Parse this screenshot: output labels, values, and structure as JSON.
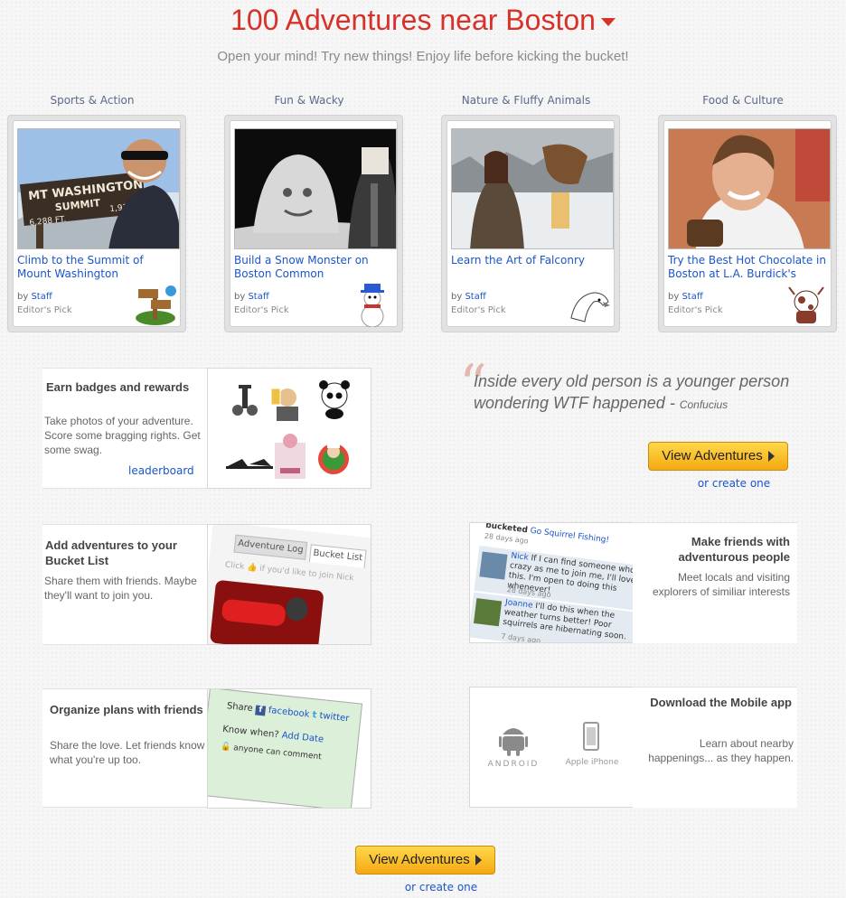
{
  "header": {
    "title": "100 Adventures near Boston",
    "tagline": "Open your mind!  Try new things!  Enjoy life before kicking the bucket!"
  },
  "categories": [
    {
      "label": "Sports & Action",
      "title": "Climb to the Summit of Mount Washington",
      "by_prefix": "by",
      "author": "Staff",
      "pick": "Editor's Pick",
      "sign": {
        "line1": "MT WASHINGTON",
        "line2": "SUMMIT",
        "left": "6,288 FT.",
        "right": "1,917M"
      }
    },
    {
      "label": "Fun & Wacky",
      "title": "Build a Snow Monster on Boston Common",
      "by_prefix": "by",
      "author": "Staff",
      "pick": "Editor's Pick"
    },
    {
      "label": "Nature & Fluffy Animals",
      "title": "Learn the Art of Falconry",
      "by_prefix": "by",
      "author": "Staff",
      "pick": "Editor's Pick"
    },
    {
      "label": "Food & Culture",
      "title": "Try the Best Hot Chocolate in Boston at L.A. Burdick's",
      "by_prefix": "by",
      "author": "Staff",
      "pick": "Editor's Pick"
    }
  ],
  "badges": {
    "heading": "Earn badges and rewards",
    "body": "Take photos of your adventure. Score some bragging rights. Get some swag.",
    "link": "leaderboard"
  },
  "quote": {
    "text": "Inside every old person is a younger person wondering WTF happened",
    "dash": " - ",
    "author": "Confucius"
  },
  "cta_top": {
    "button": "View Adventures",
    "link": "or create one"
  },
  "bucket": {
    "heading": "Add adventures to your Bucket List",
    "body": "Share them with friends. Maybe they'll want to join you.",
    "tab1": "Adventure Log",
    "tab2": "Bucket List",
    "click": "Click",
    "join_text": "if you'd like to join Nick"
  },
  "friends": {
    "heading": "Make friends with adventurous people",
    "body": "Meet  locals and visiting explorers of similiar interests",
    "feed_top": "bucketed",
    "feed_link": "Go Squirrel Fishing!",
    "feed_time1": "28 days ago",
    "c1_name": "Nick",
    "c1_text": "If I can find someone who's crazy as me to join me, I'll love this. I'm open to doing this whenever!",
    "c1_time": "28 days ago",
    "c2_name": "Joanne",
    "c2_text": "I'll do this when the weather turns better! Poor squirrels are hibernating soon.",
    "c2_time": "7 days ago"
  },
  "plans": {
    "heading": "Organize plans with friends",
    "body": "Share the love.  Let friends know what you're up too.",
    "share": "Share",
    "facebook": "facebook",
    "twitter": "twitter",
    "know_when": "Know when?",
    "add_date": "Add Date",
    "anyone": "anyone can comment"
  },
  "mobile": {
    "heading": "Download the Mobile app",
    "body": "Learn about  nearby happenings... as they happen.",
    "android": "ANDROID",
    "iphone": "Apple iPhone"
  },
  "cta_bottom": {
    "button": "View Adventures",
    "link": "or create one"
  },
  "colors": {
    "title_red": "#d8312a",
    "link_blue": "#1a55c9",
    "button_yellow": "#f5b818"
  }
}
